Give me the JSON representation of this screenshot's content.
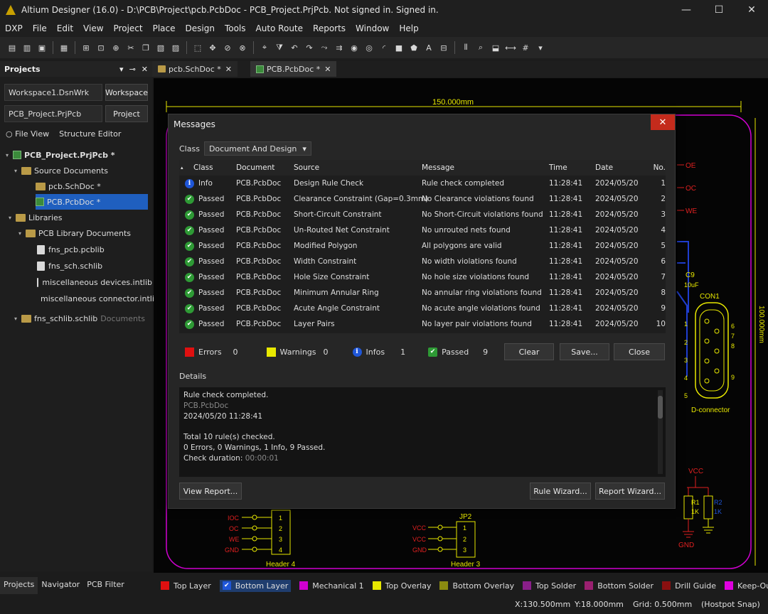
{
  "window": {
    "title": "Altium Designer (16.0) - D:\\PCB\\Project\\pcb.PcbDoc - PCB_Project.PrjPcb. Not signed in. Signed in.",
    "min": "—",
    "max": "☐",
    "close": "✕"
  },
  "menu": [
    "DXP",
    "File",
    "Edit",
    "View",
    "Project",
    "Place",
    "Design",
    "Tools",
    "Auto Route",
    "Reports",
    "Window",
    "Help"
  ],
  "projects_panel": {
    "title": "Projects",
    "workspace_combo": "Workspace1.DsnWrk",
    "workspace_button": "Workspace",
    "project_combo": "PCB_Project.PrjPcb",
    "project_button": "Project",
    "file_view": "File View",
    "structure_editor": "Structure Editor",
    "tree": {
      "project": "PCB_Project.PrjPcb *",
      "source_documents": "Source Documents",
      "sch_doc": "pcb.SchDoc *",
      "pcb_doc": "PCB.PcbDoc *",
      "libraries": "Libraries",
      "pcb_library_documents": "PCB Library Documents",
      "lib1": "fns_pcb.pcblib",
      "lib2": "fns_sch.schlib",
      "lib3": "miscellaneous devices.intlib",
      "lib4": "miscellaneous connector.intlib",
      "lib5": "fns_schlib.schlib",
      "lib5_suffix": "Documents"
    },
    "bottom_tabs": [
      "Projects",
      "Navigator",
      "PCB Filter"
    ]
  },
  "doc_tabs": [
    "pcb.SchDoc *",
    "PCB.PcbDoc *"
  ],
  "pcb": {
    "dimension": "150.000mm",
    "vertical_dimension": "100.000mm",
    "nets_right": [
      "OE",
      "OC",
      "WE"
    ],
    "c9": "C9",
    "c9_value": "10uF",
    "con1": "CON1",
    "con1_label": "D-connector",
    "con1_pins": [
      "1",
      "6",
      "2",
      "7",
      "3",
      "8",
      "4",
      "9",
      "5"
    ],
    "vcc": "VCC",
    "r1": "R1",
    "r1_value": "1K",
    "r2": "R2",
    "r2_value": "1K",
    "gnd": "GND",
    "header4_label": "Header 4",
    "header4_nets": [
      "IOC",
      "OC",
      "WE",
      "GND"
    ],
    "header4_pins": [
      "1",
      "2",
      "3",
      "4"
    ],
    "header3_ref": "JP2",
    "header3_label": "Header 3",
    "header3_nets": [
      "VCC",
      "VCC",
      "GND"
    ],
    "header3_pins": [
      "1",
      "2",
      "3"
    ]
  },
  "messages": {
    "title": "Messages",
    "close": "✕",
    "class_label": "Class",
    "class_value": "Document And Design",
    "columns": [
      "Class",
      "Document",
      "Source",
      "Message",
      "Time",
      "Date",
      "No."
    ],
    "rows": [
      {
        "class": "Info",
        "doc": "PCB.PcbDoc",
        "source": "Design Rule Check",
        "message": "Rule check completed",
        "time": "11:28:41",
        "date": "2024/05/20",
        "no": "1"
      },
      {
        "class": "Passed",
        "doc": "PCB.PcbDoc",
        "source": "Clearance Constraint (Gap=0.3mm)",
        "message": "No Clearance violations found",
        "time": "11:28:41",
        "date": "2024/05/20",
        "no": "2"
      },
      {
        "class": "Passed",
        "doc": "PCB.PcbDoc",
        "source": "Short-Circuit Constraint",
        "message": "No Short-Circuit violations found",
        "time": "11:28:41",
        "date": "2024/05/20",
        "no": "3"
      },
      {
        "class": "Passed",
        "doc": "PCB.PcbDoc",
        "source": "Un-Routed Net Constraint",
        "message": "No unrouted nets found",
        "time": "11:28:41",
        "date": "2024/05/20",
        "no": "4"
      },
      {
        "class": "Passed",
        "doc": "PCB.PcbDoc",
        "source": "Modified Polygon",
        "message": "All polygons are valid",
        "time": "11:28:41",
        "date": "2024/05/20",
        "no": "5"
      },
      {
        "class": "Passed",
        "doc": "PCB.PcbDoc",
        "source": "Width Constraint",
        "message": "No width violations found",
        "time": "11:28:41",
        "date": "2024/05/20",
        "no": "6"
      },
      {
        "class": "Passed",
        "doc": "PCB.PcbDoc",
        "source": "Hole Size Constraint",
        "message": "No hole size violations found",
        "time": "11:28:41",
        "date": "2024/05/20",
        "no": "7"
      },
      {
        "class": "Passed",
        "doc": "PCB.PcbDoc",
        "source": "Minimum Annular Ring",
        "message": "No annular ring violations found",
        "time": "11:28:41",
        "date": "2024/05/20",
        "no": "8"
      },
      {
        "class": "Passed",
        "doc": "PCB.PcbDoc",
        "source": "Acute Angle Constraint",
        "message": "No acute angle violations found",
        "time": "11:28:41",
        "date": "2024/05/20",
        "no": "9"
      },
      {
        "class": "Passed",
        "doc": "PCB.PcbDoc",
        "source": "Layer Pairs",
        "message": "No layer pair violations found",
        "time": "11:28:41",
        "date": "2024/05/20",
        "no": "10"
      }
    ],
    "summary": {
      "errors_label": "Errors",
      "errors": "0",
      "warnings_label": "Warnings",
      "warnings": "0",
      "infos_label": "Infos",
      "infos": "1",
      "passed_label": "Passed",
      "passed": "9"
    },
    "buttons": {
      "clear": "Clear",
      "save": "Save...",
      "close": "Close",
      "view_report": "View Report...",
      "rule_wizard": "Rule Wizard...",
      "report_wizard": "Report Wizard..."
    },
    "details_label": "Details",
    "details": {
      "line1": "Rule check completed.",
      "line2": "PCB.PcbDoc",
      "line3": "2024/05/20 11:28:41",
      "line4": "Total 10 rule(s) checked.",
      "line5": "0 Errors, 0 Warnings, 1 Info, 9 Passed.",
      "line6_label": "Check duration: ",
      "line6_value": "00:00:01"
    }
  },
  "layers": [
    {
      "name": "Top Layer",
      "color": "#e01010"
    },
    {
      "name": "Bottom Layer",
      "color": "#1f56d8"
    },
    {
      "name": "Mechanical 1",
      "color": "#d000d0"
    },
    {
      "name": "Top Overlay",
      "color": "#e8e800"
    },
    {
      "name": "Bottom Overlay",
      "color": "#8a8a10"
    },
    {
      "name": "Top Solder",
      "color": "#8a1f8a"
    },
    {
      "name": "Bottom Solder",
      "color": "#9a2070"
    },
    {
      "name": "Drill Guide",
      "color": "#8a1010"
    },
    {
      "name": "Keep-Out Layer",
      "color": "#e000e0"
    }
  ],
  "status": {
    "x": "X:130.500mm",
    "y": "Y:18.000mm",
    "grid": "Grid: 0.500mm",
    "snap": "(Hostpot Snap)"
  }
}
